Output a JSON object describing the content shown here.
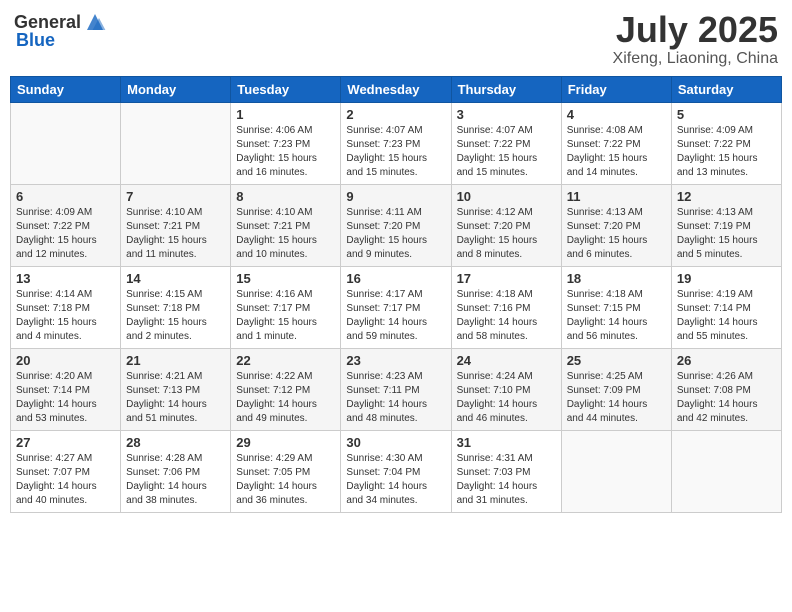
{
  "header": {
    "logo_general": "General",
    "logo_blue": "Blue",
    "month_year": "July 2025",
    "location": "Xifeng, Liaoning, China"
  },
  "weekdays": [
    "Sunday",
    "Monday",
    "Tuesday",
    "Wednesday",
    "Thursday",
    "Friday",
    "Saturday"
  ],
  "weeks": [
    [
      {
        "day": "",
        "info": ""
      },
      {
        "day": "",
        "info": ""
      },
      {
        "day": "1",
        "info": "Sunrise: 4:06 AM\nSunset: 7:23 PM\nDaylight: 15 hours\nand 16 minutes."
      },
      {
        "day": "2",
        "info": "Sunrise: 4:07 AM\nSunset: 7:23 PM\nDaylight: 15 hours\nand 15 minutes."
      },
      {
        "day": "3",
        "info": "Sunrise: 4:07 AM\nSunset: 7:22 PM\nDaylight: 15 hours\nand 15 minutes."
      },
      {
        "day": "4",
        "info": "Sunrise: 4:08 AM\nSunset: 7:22 PM\nDaylight: 15 hours\nand 14 minutes."
      },
      {
        "day": "5",
        "info": "Sunrise: 4:09 AM\nSunset: 7:22 PM\nDaylight: 15 hours\nand 13 minutes."
      }
    ],
    [
      {
        "day": "6",
        "info": "Sunrise: 4:09 AM\nSunset: 7:22 PM\nDaylight: 15 hours\nand 12 minutes."
      },
      {
        "day": "7",
        "info": "Sunrise: 4:10 AM\nSunset: 7:21 PM\nDaylight: 15 hours\nand 11 minutes."
      },
      {
        "day": "8",
        "info": "Sunrise: 4:10 AM\nSunset: 7:21 PM\nDaylight: 15 hours\nand 10 minutes."
      },
      {
        "day": "9",
        "info": "Sunrise: 4:11 AM\nSunset: 7:20 PM\nDaylight: 15 hours\nand 9 minutes."
      },
      {
        "day": "10",
        "info": "Sunrise: 4:12 AM\nSunset: 7:20 PM\nDaylight: 15 hours\nand 8 minutes."
      },
      {
        "day": "11",
        "info": "Sunrise: 4:13 AM\nSunset: 7:20 PM\nDaylight: 15 hours\nand 6 minutes."
      },
      {
        "day": "12",
        "info": "Sunrise: 4:13 AM\nSunset: 7:19 PM\nDaylight: 15 hours\nand 5 minutes."
      }
    ],
    [
      {
        "day": "13",
        "info": "Sunrise: 4:14 AM\nSunset: 7:18 PM\nDaylight: 15 hours\nand 4 minutes."
      },
      {
        "day": "14",
        "info": "Sunrise: 4:15 AM\nSunset: 7:18 PM\nDaylight: 15 hours\nand 2 minutes."
      },
      {
        "day": "15",
        "info": "Sunrise: 4:16 AM\nSunset: 7:17 PM\nDaylight: 15 hours\nand 1 minute."
      },
      {
        "day": "16",
        "info": "Sunrise: 4:17 AM\nSunset: 7:17 PM\nDaylight: 14 hours\nand 59 minutes."
      },
      {
        "day": "17",
        "info": "Sunrise: 4:18 AM\nSunset: 7:16 PM\nDaylight: 14 hours\nand 58 minutes."
      },
      {
        "day": "18",
        "info": "Sunrise: 4:18 AM\nSunset: 7:15 PM\nDaylight: 14 hours\nand 56 minutes."
      },
      {
        "day": "19",
        "info": "Sunrise: 4:19 AM\nSunset: 7:14 PM\nDaylight: 14 hours\nand 55 minutes."
      }
    ],
    [
      {
        "day": "20",
        "info": "Sunrise: 4:20 AM\nSunset: 7:14 PM\nDaylight: 14 hours\nand 53 minutes."
      },
      {
        "day": "21",
        "info": "Sunrise: 4:21 AM\nSunset: 7:13 PM\nDaylight: 14 hours\nand 51 minutes."
      },
      {
        "day": "22",
        "info": "Sunrise: 4:22 AM\nSunset: 7:12 PM\nDaylight: 14 hours\nand 49 minutes."
      },
      {
        "day": "23",
        "info": "Sunrise: 4:23 AM\nSunset: 7:11 PM\nDaylight: 14 hours\nand 48 minutes."
      },
      {
        "day": "24",
        "info": "Sunrise: 4:24 AM\nSunset: 7:10 PM\nDaylight: 14 hours\nand 46 minutes."
      },
      {
        "day": "25",
        "info": "Sunrise: 4:25 AM\nSunset: 7:09 PM\nDaylight: 14 hours\nand 44 minutes."
      },
      {
        "day": "26",
        "info": "Sunrise: 4:26 AM\nSunset: 7:08 PM\nDaylight: 14 hours\nand 42 minutes."
      }
    ],
    [
      {
        "day": "27",
        "info": "Sunrise: 4:27 AM\nSunset: 7:07 PM\nDaylight: 14 hours\nand 40 minutes."
      },
      {
        "day": "28",
        "info": "Sunrise: 4:28 AM\nSunset: 7:06 PM\nDaylight: 14 hours\nand 38 minutes."
      },
      {
        "day": "29",
        "info": "Sunrise: 4:29 AM\nSunset: 7:05 PM\nDaylight: 14 hours\nand 36 minutes."
      },
      {
        "day": "30",
        "info": "Sunrise: 4:30 AM\nSunset: 7:04 PM\nDaylight: 14 hours\nand 34 minutes."
      },
      {
        "day": "31",
        "info": "Sunrise: 4:31 AM\nSunset: 7:03 PM\nDaylight: 14 hours\nand 31 minutes."
      },
      {
        "day": "",
        "info": ""
      },
      {
        "day": "",
        "info": ""
      }
    ]
  ]
}
